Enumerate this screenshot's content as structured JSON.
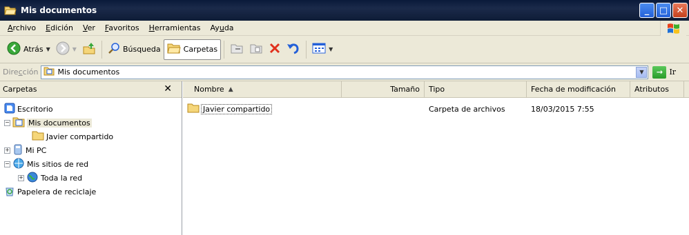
{
  "window": {
    "title": "Mis documentos",
    "minimize": "_",
    "maximize": "□",
    "close": "✕"
  },
  "menu": {
    "items": [
      {
        "prefix": "",
        "accel": "A",
        "rest": "rchivo"
      },
      {
        "prefix": "",
        "accel": "E",
        "rest": "dición"
      },
      {
        "prefix": "",
        "accel": "V",
        "rest": "er"
      },
      {
        "prefix": "",
        "accel": "F",
        "rest": "avoritos"
      },
      {
        "prefix": "",
        "accel": "H",
        "rest": "erramientas"
      },
      {
        "prefix": "Ay",
        "accel": "u",
        "rest": "da"
      }
    ]
  },
  "toolbar": {
    "back": "Atrás",
    "search": "Búsqueda",
    "folders": "Carpetas"
  },
  "address": {
    "label_pre": "Dire",
    "label_accel": "c",
    "label_post": "ción",
    "value": "Mis documentos",
    "go": "Ir"
  },
  "folders_panel": {
    "title": "Carpetas",
    "close": "✕",
    "tree": [
      {
        "label": "Escritorio",
        "exp": ""
      },
      {
        "label": "Mis documentos",
        "exp": "−"
      },
      {
        "label": "Javier compartido",
        "exp": ""
      },
      {
        "label": "Mi PC",
        "exp": "+"
      },
      {
        "label": "Mis sitios de red",
        "exp": "−"
      },
      {
        "label": "Toda la red",
        "exp": "+"
      },
      {
        "label": "Papelera de reciclaje",
        "exp": ""
      }
    ]
  },
  "list": {
    "columns": {
      "name": "Nombre",
      "size": "Tamaño",
      "type": "Tipo",
      "modified": "Fecha de modificación",
      "attributes": "Atributos"
    },
    "rows": [
      {
        "name": "Javier compartido",
        "size": "",
        "type": "Carpeta de archivos",
        "modified": "18/03/2015 7:55",
        "attributes": ""
      }
    ]
  }
}
